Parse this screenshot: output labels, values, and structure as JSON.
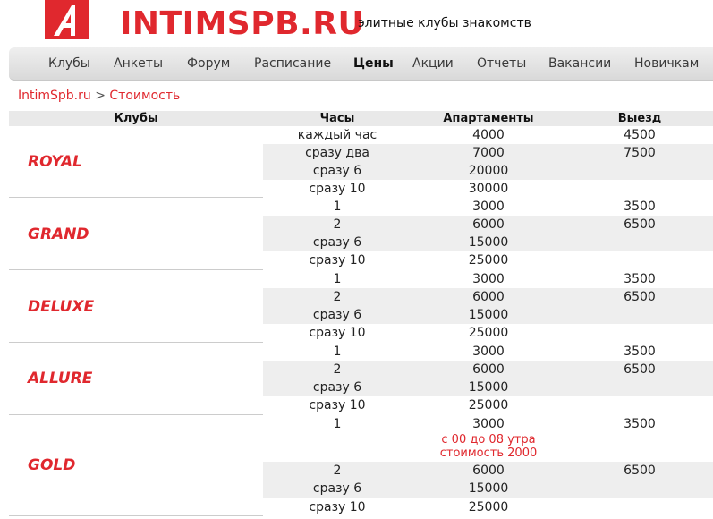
{
  "header": {
    "brand": "INTIMSPB.RU",
    "tagline": "элитные клубы знакомств",
    "logo_icon": "red-square-a-logo-icon",
    "accent_color": "#e0282e"
  },
  "nav": {
    "items": [
      {
        "label": "Клубы"
      },
      {
        "label": "Анкеты"
      },
      {
        "label": "Форум"
      },
      {
        "label": "Расписание"
      },
      {
        "label": "Цены",
        "active": true
      },
      {
        "label": "Акции"
      },
      {
        "label": "Отчеты"
      },
      {
        "label": "Вакансии"
      },
      {
        "label": "Новичкам"
      }
    ]
  },
  "breadcrumb": {
    "home": "IntimSpb.ru",
    "separator": ">",
    "current": "Стоимость"
  },
  "table": {
    "headers": {
      "clubs": "Клубы",
      "hours": "Часы",
      "apartments": "Апартаменты",
      "outcall": "Выезд"
    },
    "clubs": [
      {
        "name": "ROYAL",
        "rows": [
          {
            "hours": "каждый час",
            "apartments": "4000",
            "outcall": "4500"
          },
          {
            "hours": "сразу два",
            "apartments": "7000",
            "outcall": "7500"
          },
          {
            "hours": "сразу 6",
            "apartments": "20000",
            "outcall": ""
          },
          {
            "hours": "сразу 10",
            "apartments": "30000",
            "outcall": ""
          }
        ]
      },
      {
        "name": "GRAND",
        "rows": [
          {
            "hours": "1",
            "apartments": "3000",
            "outcall": "3500"
          },
          {
            "hours": "2",
            "apartments": "6000",
            "outcall": "6500"
          },
          {
            "hours": "сразу 6",
            "apartments": "15000",
            "outcall": ""
          },
          {
            "hours": "сразу 10",
            "apartments": "25000",
            "outcall": ""
          }
        ]
      },
      {
        "name": "DELUXE",
        "rows": [
          {
            "hours": "1",
            "apartments": "3000",
            "outcall": "3500"
          },
          {
            "hours": "2",
            "apartments": "6000",
            "outcall": "6500"
          },
          {
            "hours": "сразу 6",
            "apartments": "15000",
            "outcall": ""
          },
          {
            "hours": "сразу 10",
            "apartments": "25000",
            "outcall": ""
          }
        ]
      },
      {
        "name": "ALLURE",
        "rows": [
          {
            "hours": "1",
            "apartments": "3000",
            "outcall": "3500"
          },
          {
            "hours": "2",
            "apartments": "6000",
            "outcall": "6500"
          },
          {
            "hours": "сразу 6",
            "apartments": "15000",
            "outcall": ""
          },
          {
            "hours": "сразу 10",
            "apartments": "25000",
            "outcall": ""
          }
        ]
      },
      {
        "name": "GOLD",
        "rows": [
          {
            "hours": "1",
            "apartments": "3000",
            "outcall": "3500",
            "note_line1": "с 00 до 08 утра",
            "note_line2": "стоимость 2000"
          },
          {
            "hours": "2",
            "apartments": "6000",
            "outcall": "6500"
          },
          {
            "hours": "сразу 6",
            "apartments": "15000",
            "outcall": ""
          },
          {
            "hours": "сразу 10",
            "apartments": "25000",
            "outcall": ""
          }
        ]
      }
    ]
  }
}
